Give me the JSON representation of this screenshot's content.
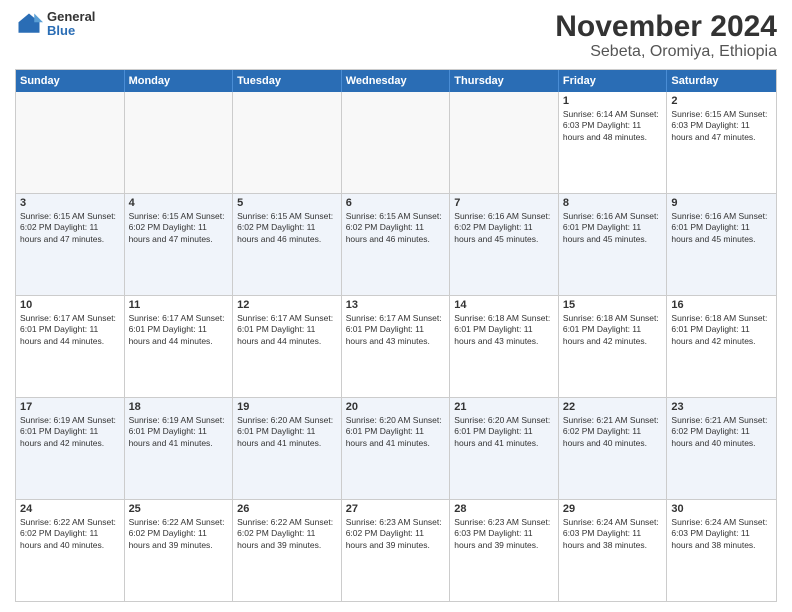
{
  "logo": {
    "general": "General",
    "blue": "Blue"
  },
  "title": "November 2024",
  "subtitle": "Sebeta, Oromiya, Ethiopia",
  "days_of_week": [
    "Sunday",
    "Monday",
    "Tuesday",
    "Wednesday",
    "Thursday",
    "Friday",
    "Saturday"
  ],
  "weeks": [
    [
      {
        "day": "",
        "info": "",
        "empty": true
      },
      {
        "day": "",
        "info": "",
        "empty": true
      },
      {
        "day": "",
        "info": "",
        "empty": true
      },
      {
        "day": "",
        "info": "",
        "empty": true
      },
      {
        "day": "",
        "info": "",
        "empty": true
      },
      {
        "day": "1",
        "info": "Sunrise: 6:14 AM\nSunset: 6:03 PM\nDaylight: 11 hours\nand 48 minutes.",
        "empty": false
      },
      {
        "day": "2",
        "info": "Sunrise: 6:15 AM\nSunset: 6:03 PM\nDaylight: 11 hours\nand 47 minutes.",
        "empty": false
      }
    ],
    [
      {
        "day": "3",
        "info": "Sunrise: 6:15 AM\nSunset: 6:02 PM\nDaylight: 11 hours\nand 47 minutes.",
        "empty": false
      },
      {
        "day": "4",
        "info": "Sunrise: 6:15 AM\nSunset: 6:02 PM\nDaylight: 11 hours\nand 47 minutes.",
        "empty": false
      },
      {
        "day": "5",
        "info": "Sunrise: 6:15 AM\nSunset: 6:02 PM\nDaylight: 11 hours\nand 46 minutes.",
        "empty": false
      },
      {
        "day": "6",
        "info": "Sunrise: 6:15 AM\nSunset: 6:02 PM\nDaylight: 11 hours\nand 46 minutes.",
        "empty": false
      },
      {
        "day": "7",
        "info": "Sunrise: 6:16 AM\nSunset: 6:02 PM\nDaylight: 11 hours\nand 45 minutes.",
        "empty": false
      },
      {
        "day": "8",
        "info": "Sunrise: 6:16 AM\nSunset: 6:01 PM\nDaylight: 11 hours\nand 45 minutes.",
        "empty": false
      },
      {
        "day": "9",
        "info": "Sunrise: 6:16 AM\nSunset: 6:01 PM\nDaylight: 11 hours\nand 45 minutes.",
        "empty": false
      }
    ],
    [
      {
        "day": "10",
        "info": "Sunrise: 6:17 AM\nSunset: 6:01 PM\nDaylight: 11 hours\nand 44 minutes.",
        "empty": false
      },
      {
        "day": "11",
        "info": "Sunrise: 6:17 AM\nSunset: 6:01 PM\nDaylight: 11 hours\nand 44 minutes.",
        "empty": false
      },
      {
        "day": "12",
        "info": "Sunrise: 6:17 AM\nSunset: 6:01 PM\nDaylight: 11 hours\nand 44 minutes.",
        "empty": false
      },
      {
        "day": "13",
        "info": "Sunrise: 6:17 AM\nSunset: 6:01 PM\nDaylight: 11 hours\nand 43 minutes.",
        "empty": false
      },
      {
        "day": "14",
        "info": "Sunrise: 6:18 AM\nSunset: 6:01 PM\nDaylight: 11 hours\nand 43 minutes.",
        "empty": false
      },
      {
        "day": "15",
        "info": "Sunrise: 6:18 AM\nSunset: 6:01 PM\nDaylight: 11 hours\nand 42 minutes.",
        "empty": false
      },
      {
        "day": "16",
        "info": "Sunrise: 6:18 AM\nSunset: 6:01 PM\nDaylight: 11 hours\nand 42 minutes.",
        "empty": false
      }
    ],
    [
      {
        "day": "17",
        "info": "Sunrise: 6:19 AM\nSunset: 6:01 PM\nDaylight: 11 hours\nand 42 minutes.",
        "empty": false
      },
      {
        "day": "18",
        "info": "Sunrise: 6:19 AM\nSunset: 6:01 PM\nDaylight: 11 hours\nand 41 minutes.",
        "empty": false
      },
      {
        "day": "19",
        "info": "Sunrise: 6:20 AM\nSunset: 6:01 PM\nDaylight: 11 hours\nand 41 minutes.",
        "empty": false
      },
      {
        "day": "20",
        "info": "Sunrise: 6:20 AM\nSunset: 6:01 PM\nDaylight: 11 hours\nand 41 minutes.",
        "empty": false
      },
      {
        "day": "21",
        "info": "Sunrise: 6:20 AM\nSunset: 6:01 PM\nDaylight: 11 hours\nand 41 minutes.",
        "empty": false
      },
      {
        "day": "22",
        "info": "Sunrise: 6:21 AM\nSunset: 6:02 PM\nDaylight: 11 hours\nand 40 minutes.",
        "empty": false
      },
      {
        "day": "23",
        "info": "Sunrise: 6:21 AM\nSunset: 6:02 PM\nDaylight: 11 hours\nand 40 minutes.",
        "empty": false
      }
    ],
    [
      {
        "day": "24",
        "info": "Sunrise: 6:22 AM\nSunset: 6:02 PM\nDaylight: 11 hours\nand 40 minutes.",
        "empty": false
      },
      {
        "day": "25",
        "info": "Sunrise: 6:22 AM\nSunset: 6:02 PM\nDaylight: 11 hours\nand 39 minutes.",
        "empty": false
      },
      {
        "day": "26",
        "info": "Sunrise: 6:22 AM\nSunset: 6:02 PM\nDaylight: 11 hours\nand 39 minutes.",
        "empty": false
      },
      {
        "day": "27",
        "info": "Sunrise: 6:23 AM\nSunset: 6:02 PM\nDaylight: 11 hours\nand 39 minutes.",
        "empty": false
      },
      {
        "day": "28",
        "info": "Sunrise: 6:23 AM\nSunset: 6:03 PM\nDaylight: 11 hours\nand 39 minutes.",
        "empty": false
      },
      {
        "day": "29",
        "info": "Sunrise: 6:24 AM\nSunset: 6:03 PM\nDaylight: 11 hours\nand 38 minutes.",
        "empty": false
      },
      {
        "day": "30",
        "info": "Sunrise: 6:24 AM\nSunset: 6:03 PM\nDaylight: 11 hours\nand 38 minutes.",
        "empty": false
      }
    ]
  ]
}
